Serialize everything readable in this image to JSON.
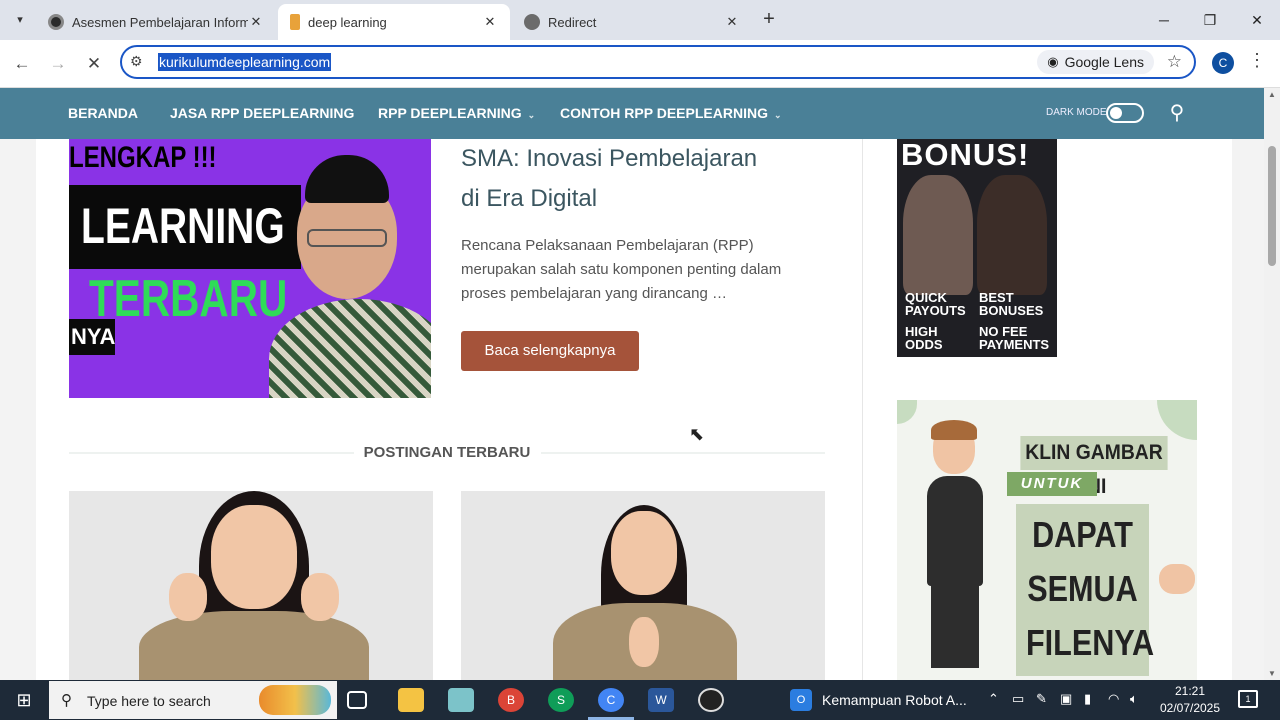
{
  "browser": {
    "tabs": [
      {
        "title": "Asesmen Pembelajaran Informa",
        "favicon_color": "#2b2b2b"
      },
      {
        "title": "deep learning",
        "favicon_color": "#e8a23a"
      },
      {
        "title": "Redirect",
        "favicon_color": "#6b6b6b"
      }
    ],
    "url": "kurikulumdeeplearning.com",
    "lens_label": "Google Lens",
    "profile_initial": "C"
  },
  "site": {
    "nav": [
      {
        "label": "BERANDA",
        "dropdown": false
      },
      {
        "label": "JASA RPP DEEPLEARNING",
        "dropdown": false
      },
      {
        "label": "RPP DEEPLEARNING",
        "dropdown": true
      },
      {
        "label": "CONTOH RPP DEEPLEARNING",
        "dropdown": true
      }
    ],
    "dark_mode_label": "DARK MODE",
    "dark_mode_on": false
  },
  "featured": {
    "image_texts": {
      "top": "LENGKAP !!!",
      "middle": "LEARNING",
      "bottom": "TERBARU",
      "left": "NYA"
    },
    "title_line1": "SMA: Inovasi Pembelajaran",
    "title_line2": "di Era Digital",
    "excerpt": "Rencana Pelaksanaan Pembelajaran (RPP) merupakan salah satu komponen penting dalam proses pembelajaran yang dirancang …",
    "button_label": "Baca selengkapnya"
  },
  "recent": {
    "heading": "POSTINGAN TERBARU"
  },
  "sidebar": {
    "ad1": {
      "headline": "BONUS!",
      "bullets": [
        "QUICK PAYOUTS",
        "BEST BONUSES",
        "HIGH ODDS",
        "NO FEE PAYMENTS"
      ]
    },
    "ad2": {
      "line1": "KLIN GAMBAR INI",
      "line2": "UNTUK",
      "big1": "DAPAT",
      "big2": "SEMUA",
      "big3": "FILENYA"
    }
  },
  "taskbar": {
    "search_placeholder": "Type here to search",
    "active_app": "Kemampuan Robot A...",
    "time": "21:21",
    "date": "02/07/2025",
    "notification_count": "1",
    "pinned": [
      "task-view",
      "file-explorer",
      "notepad",
      "chrome-b",
      "chrome-s",
      "chrome-c",
      "word",
      "obs"
    ]
  }
}
